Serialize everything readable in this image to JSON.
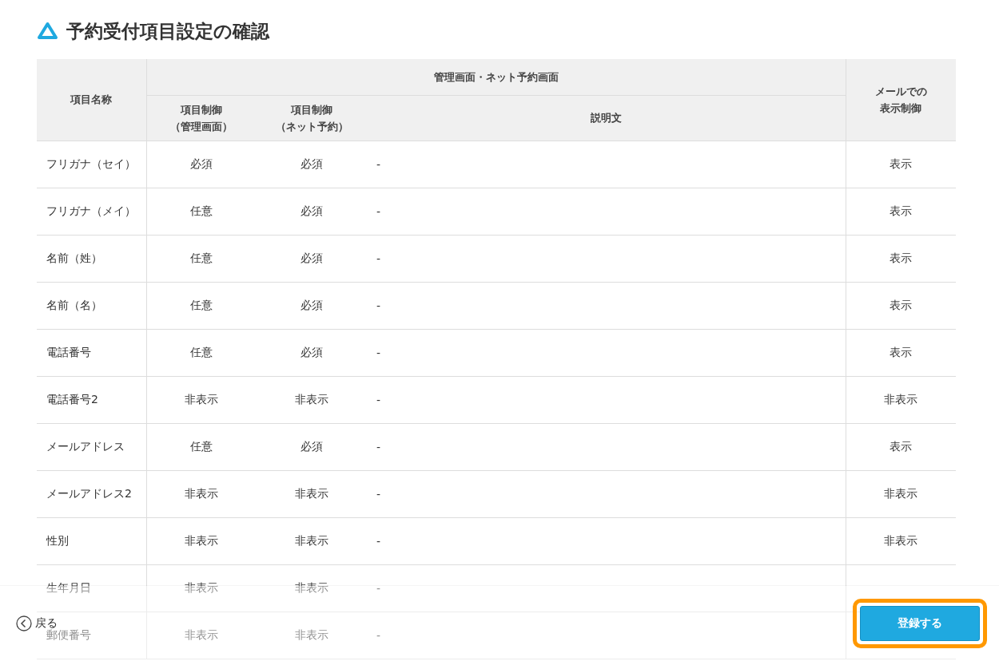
{
  "title": "予約受付項目設定の確認",
  "table": {
    "columns": {
      "name": "項目名称",
      "group": "管理画面・ネット予約画面",
      "admin": [
        "項目制御",
        "（管理画面）"
      ],
      "net": [
        "項目制御",
        "（ネット予約）"
      ],
      "description": "説明文",
      "mail": [
        "メールでの",
        "表示制御"
      ]
    },
    "rows": [
      {
        "name": "フリガナ（セイ）",
        "admin": "必須",
        "net": "必須",
        "description": "-",
        "mail": "表示"
      },
      {
        "name": "フリガナ（メイ）",
        "admin": "任意",
        "net": "必須",
        "description": "-",
        "mail": "表示"
      },
      {
        "name": "名前（姓）",
        "admin": "任意",
        "net": "必須",
        "description": "-",
        "mail": "表示"
      },
      {
        "name": "名前（名）",
        "admin": "任意",
        "net": "必須",
        "description": "-",
        "mail": "表示"
      },
      {
        "name": "電話番号",
        "admin": "任意",
        "net": "必須",
        "description": "-",
        "mail": "表示"
      },
      {
        "name": "電話番号2",
        "admin": "非表示",
        "net": "非表示",
        "description": "-",
        "mail": "非表示"
      },
      {
        "name": "メールアドレス",
        "admin": "任意",
        "net": "必須",
        "description": "-",
        "mail": "表示"
      },
      {
        "name": "メールアドレス2",
        "admin": "非表示",
        "net": "非表示",
        "description": "-",
        "mail": "非表示"
      },
      {
        "name": "性別",
        "admin": "非表示",
        "net": "非表示",
        "description": "-",
        "mail": "非表示"
      },
      {
        "name": "生年月日",
        "admin": "非表示",
        "net": "非表示",
        "description": "-"
      },
      {
        "name": "郵便番号",
        "admin": "非表示",
        "net": "非表示",
        "description": "-"
      }
    ]
  },
  "footer": {
    "back": "戻る",
    "submit": "登録する"
  }
}
